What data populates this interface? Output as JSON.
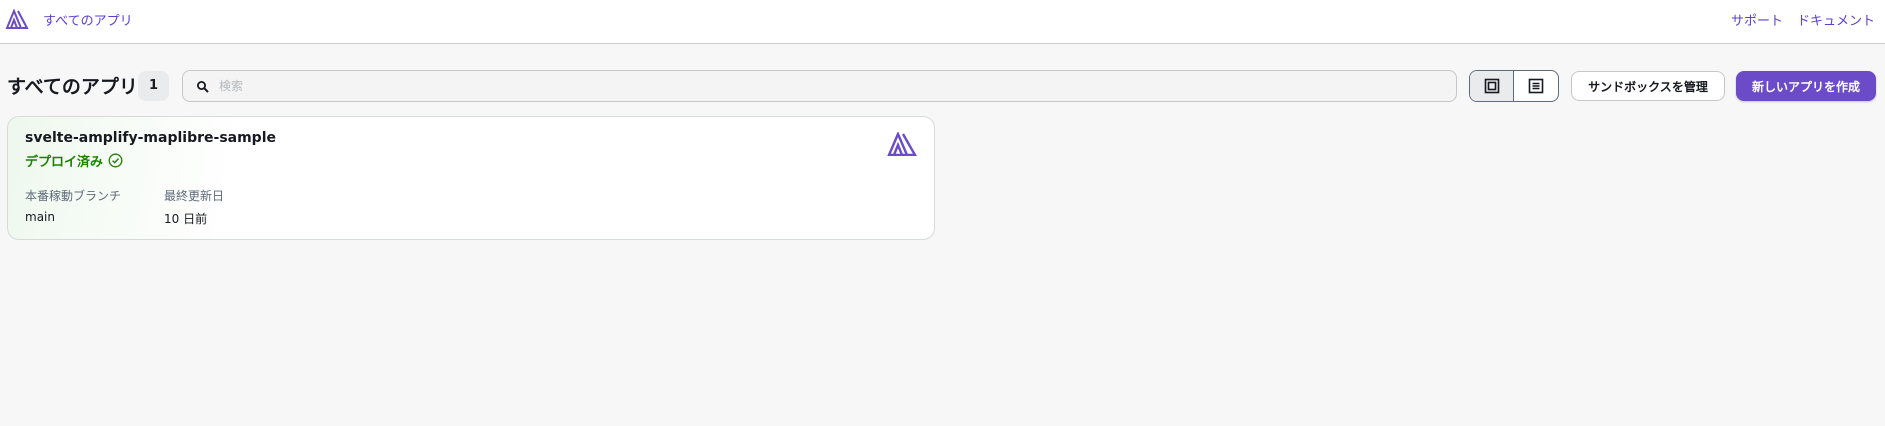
{
  "header": {
    "logo_icon": "amplify-logo-icon",
    "breadcrumb": "すべてのアプリ",
    "links": [
      "サポート",
      "ドキュメント"
    ]
  },
  "toolbar": {
    "title": "すべてのアプリ",
    "count": "1",
    "search_placeholder": "検索",
    "search_value": "",
    "view_modes": [
      "grid-view-icon",
      "list-view-icon"
    ],
    "active_view": "grid",
    "manage_sandbox_label": "サンドボックスを管理",
    "create_app_label": "新しいアプリを作成"
  },
  "apps": [
    {
      "name": "svelte-amplify-maplibre-sample",
      "status": "デプロイ済み",
      "status_color": "#1d8102",
      "branch_label": "本番稼動ブランチ",
      "branch_value": "main",
      "updated_label": "最終更新日",
      "updated_value": "10 日前"
    }
  ],
  "colors": {
    "accent": "#5b3fd3",
    "primary_button": "#6b4bc7",
    "success": "#1d8102"
  }
}
